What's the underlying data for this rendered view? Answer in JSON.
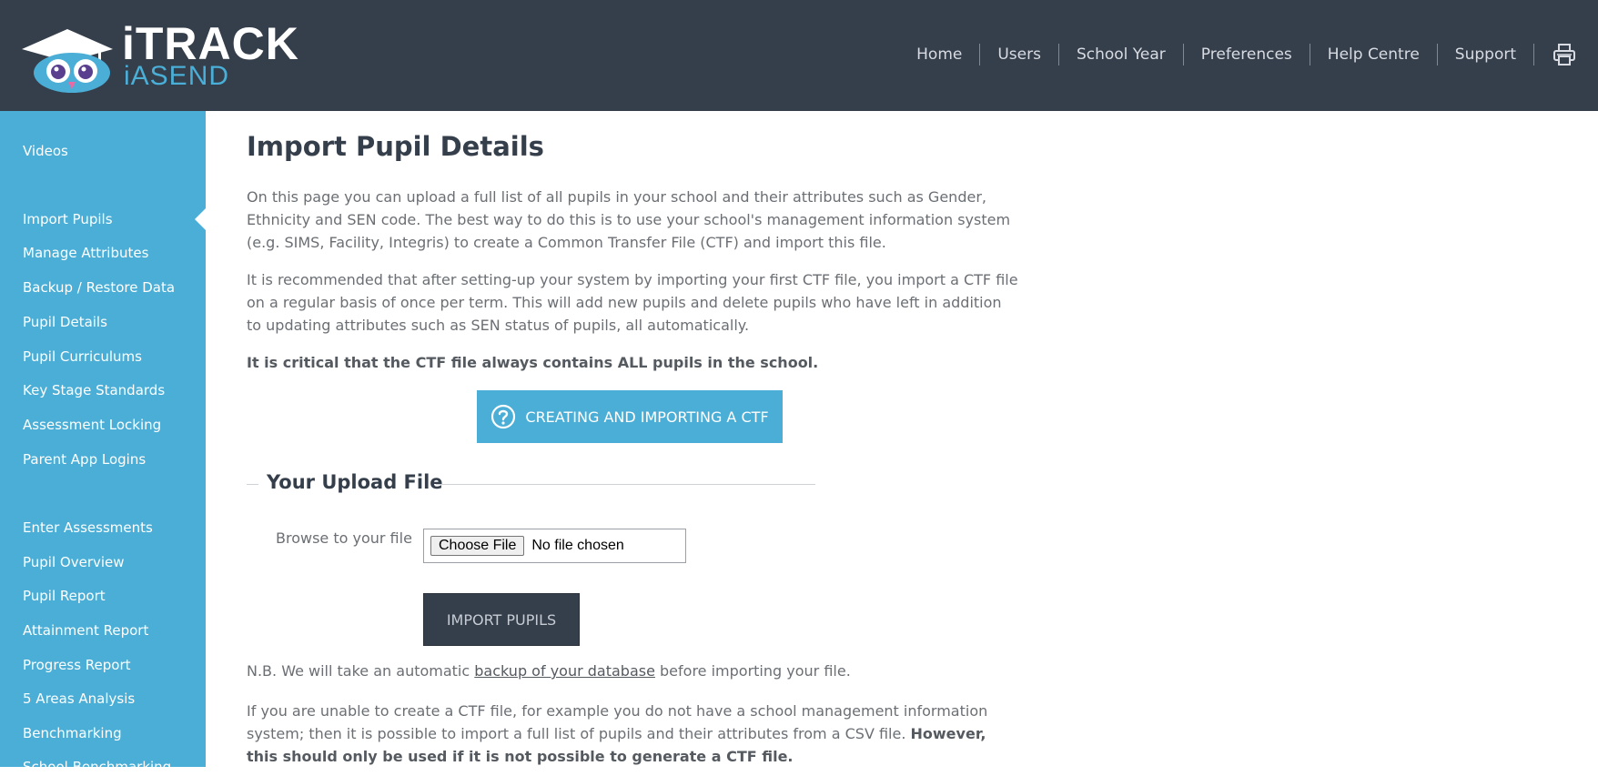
{
  "header": {
    "logo_top": "iTRACK",
    "logo_bottom": "iASEND",
    "nav": [
      "Home",
      "Users",
      "School Year",
      "Preferences",
      "Help Centre",
      "Support"
    ],
    "print_icon": "printer-icon"
  },
  "sidebar": {
    "group1": [
      "Videos"
    ],
    "group2": [
      "Import Pupils",
      "Manage Attributes",
      "Backup / Restore Data",
      "Pupil Details",
      "Pupil Curriculums",
      "Key Stage Standards",
      "Assessment Locking",
      "Parent App Logins"
    ],
    "group3": [
      "Enter Assessments",
      "Pupil Overview",
      "Pupil Report",
      "Attainment Report",
      "Progress Report",
      "5 Areas Analysis",
      "Benchmarking",
      "School Benchmarking"
    ],
    "active": "Import Pupils"
  },
  "main": {
    "title": "Import Pupil Details",
    "para1": "On this page you can upload a full list of all pupils in your school and their attributes such as Gender, Ethnicity and SEN code. The best way to do this is to use your school's management information system (e.g. SIMS, Facility, Integris) to create a Common Transfer File (CTF) and import this file.",
    "para2": "It is recommended that after setting-up your system by importing your first CTF file, you import a CTF file on a regular basis of once per term. This will add new pupils and delete pupils who have left in addition to updating attributes such as SEN status of pupils, all automatically.",
    "critical": "It is critical that the CTF file always contains ALL pupils in the school.",
    "ctf_button": "CREATING AND IMPORTING A CTF",
    "upload_heading": "Your Upload File",
    "browse_label": "Browse to your file",
    "choose_file": "Choose File",
    "no_file": "No file chosen",
    "import_button": "IMPORT PUPILS",
    "nb_prefix": "N.B. We will take an automatic ",
    "nb_link": "backup of your database",
    "nb_suffix": " before importing your file.",
    "csv_para_normal": "If you are unable to create a CTF file, for example you do not have a school management information system; then it is possible to import a full list of pupils and their attributes from a CSV file. ",
    "csv_para_bold": "However, this should only be used if it is not possible to generate a CTF file."
  },
  "colors": {
    "header_bg": "#353e4b",
    "sidebar_bg": "#4aaed6",
    "accent": "#4aaed6",
    "dark_button": "#353e4b"
  }
}
